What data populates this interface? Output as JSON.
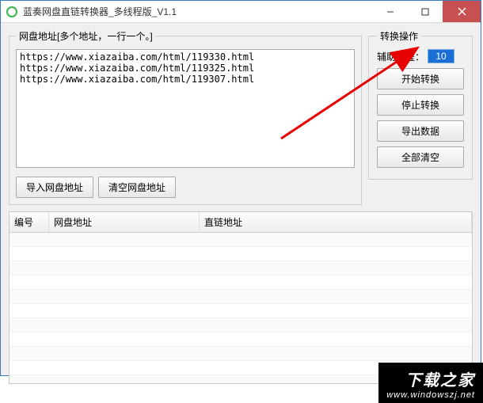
{
  "window": {
    "title": "蓝奏网盘直链转换器_多线程版_V1.1"
  },
  "left_panel": {
    "legend": "网盘地址[多个地址，一行一个。]",
    "addresses": "https://www.xiazaiba.com/html/119330.html\nhttps://www.xiazaiba.com/html/119325.html\nhttps://www.xiazaiba.com/html/119307.html",
    "import_btn": "导入网盘地址",
    "clear_btn": "清空网盘地址"
  },
  "right_panel": {
    "legend": "转换操作",
    "thread_label": "辅助线程：",
    "thread_value": "10",
    "start_btn": "开始转换",
    "stop_btn": "停止转换",
    "export_btn": "导出数据",
    "clearall_btn": "全部清空"
  },
  "table": {
    "col1": "编号",
    "col2": "网盘地址",
    "col3": "直链地址"
  },
  "watermark": {
    "name": "下载之家",
    "url": "www.windowszj.net"
  }
}
